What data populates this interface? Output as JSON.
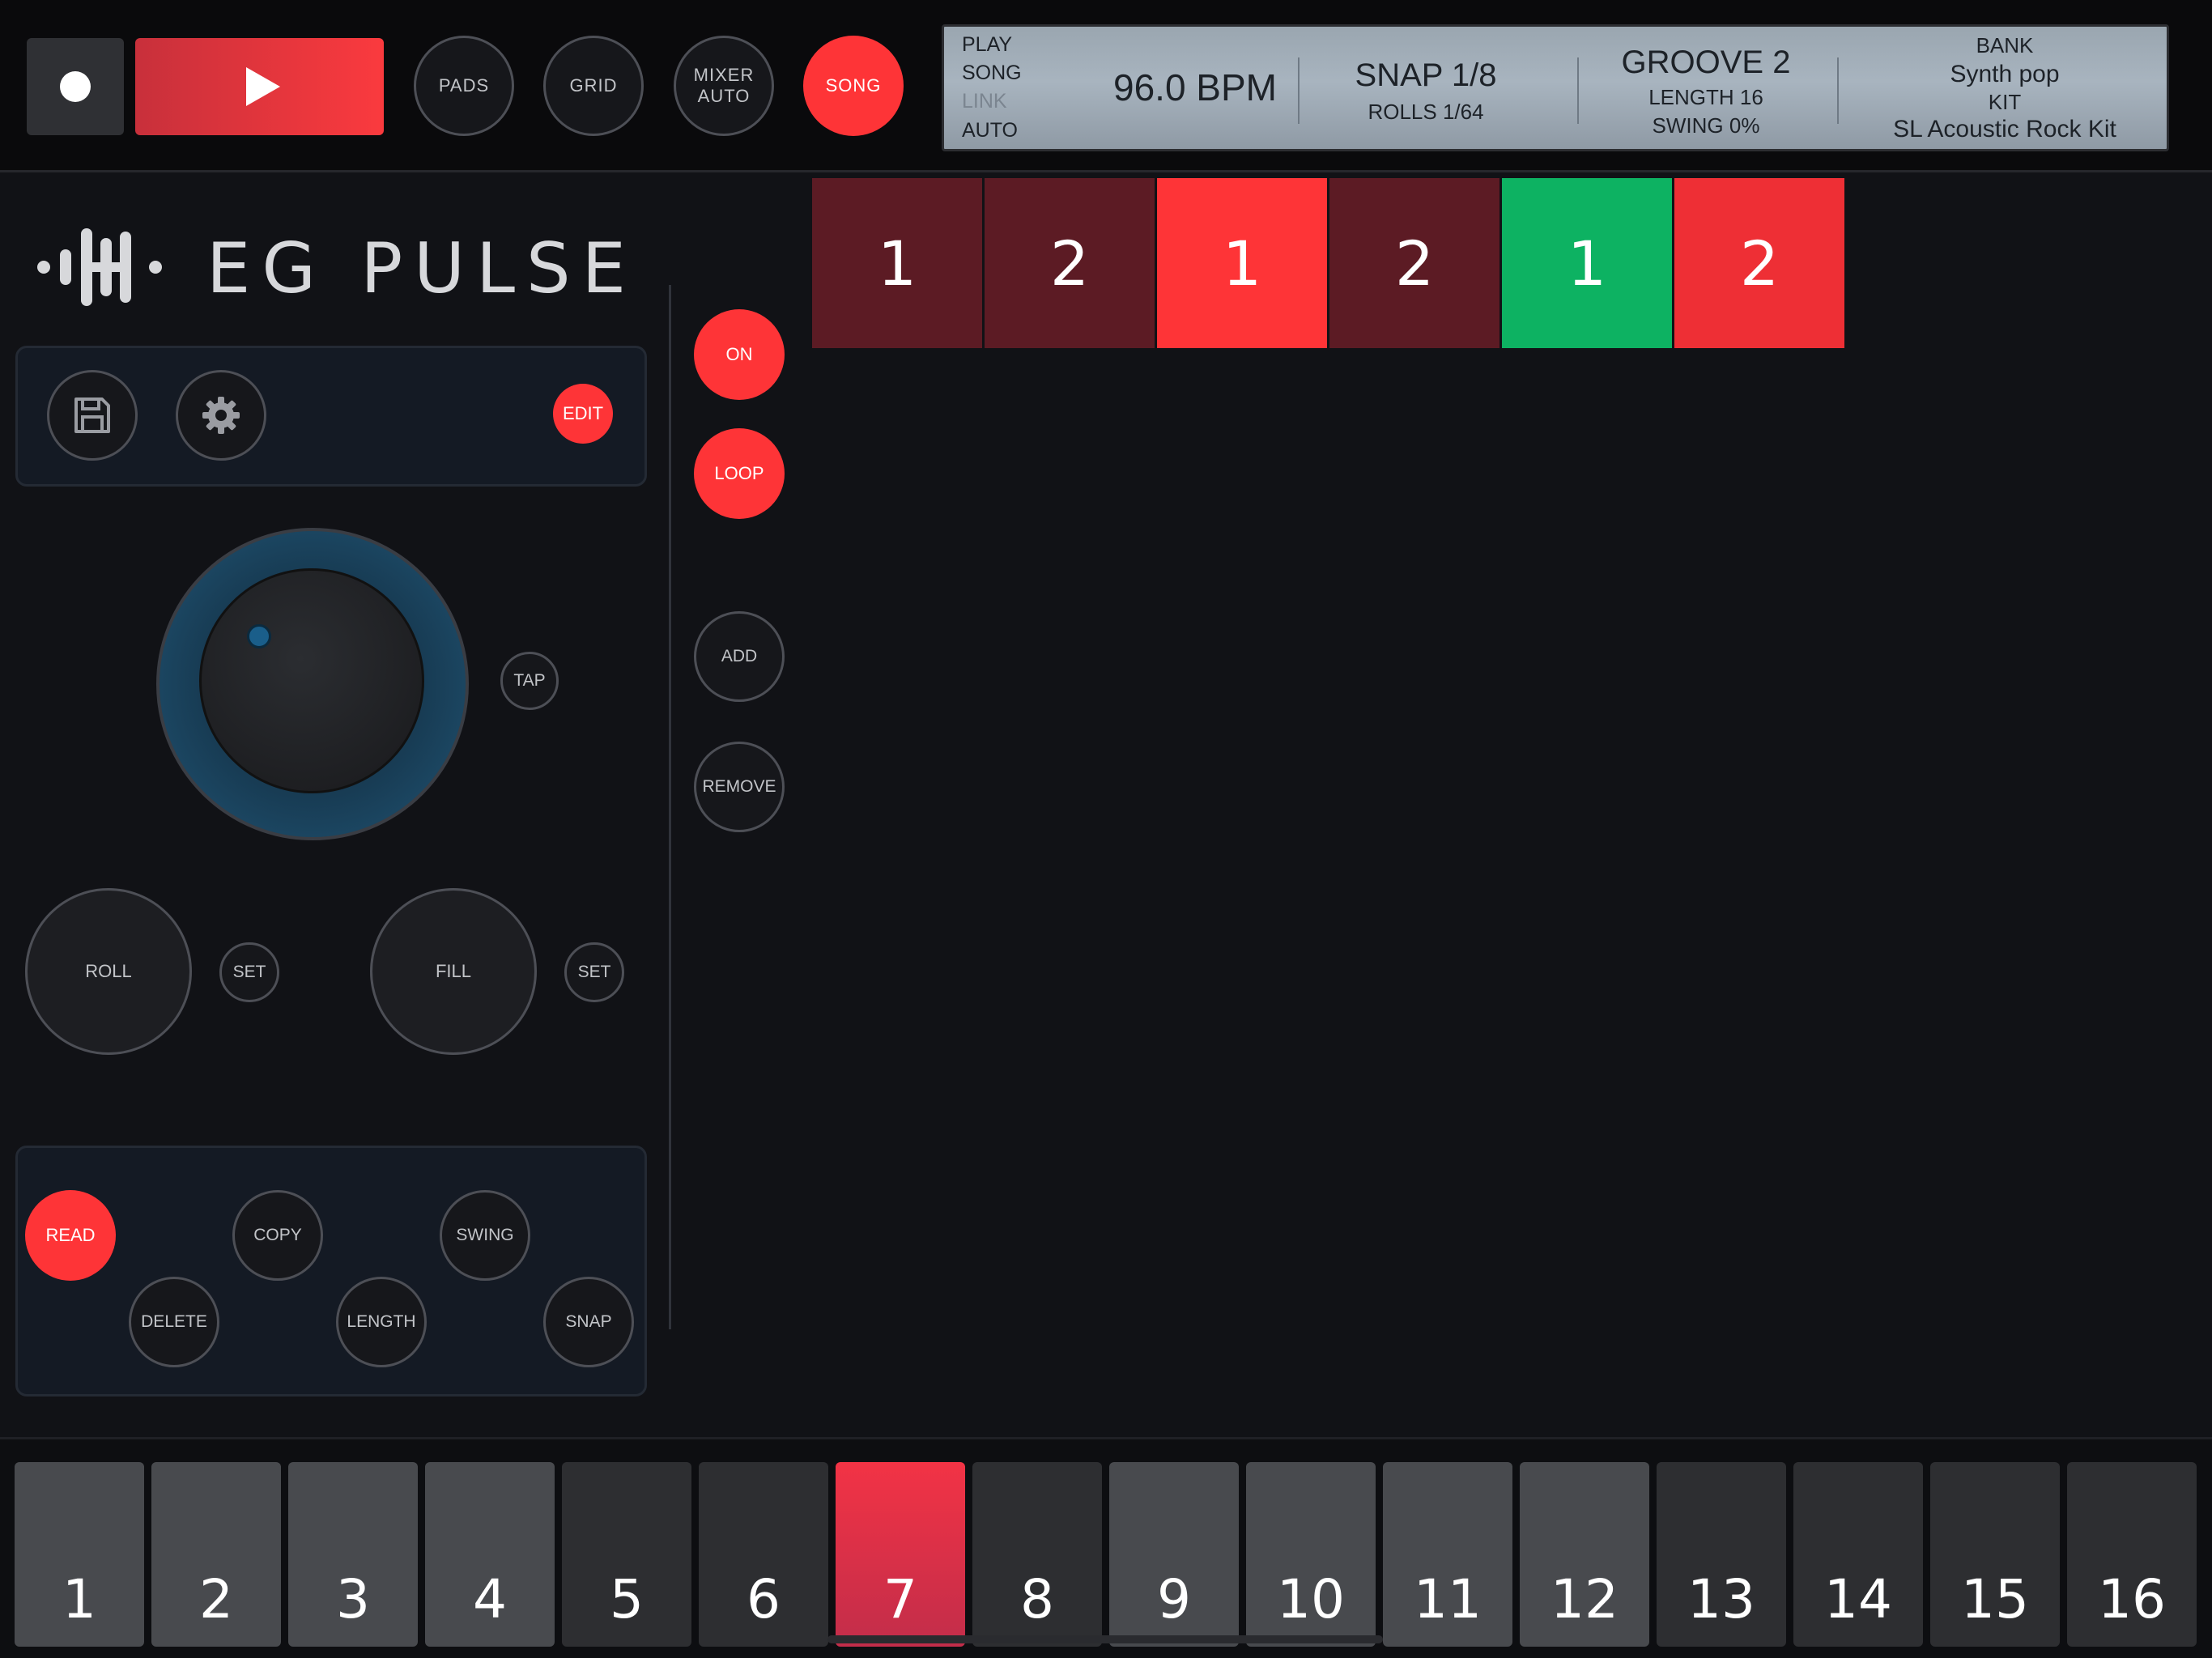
{
  "transport": {
    "record_icon": "record-icon",
    "play_icon": "play-icon"
  },
  "top_buttons": {
    "pads": "PADS",
    "grid": "GRID",
    "mixer_line1": "MIXER",
    "mixer_line2": "AUTO",
    "song": "SONG"
  },
  "lcd": {
    "modes": {
      "play": "PLAY",
      "song": "SONG",
      "link": "LINK",
      "auto": "AUTO"
    },
    "bpm": "96.0 BPM",
    "snap": "SNAP 1/8",
    "rolls": "ROLLS 1/64",
    "groove": "GROOVE 2",
    "length": "LENGTH 16",
    "swing": "SWING 0%",
    "bank_label": "BANK",
    "bank_value": "Synth pop",
    "kit_label": "KIT",
    "kit_value": "SL Acoustic Rock Kit"
  },
  "logo": {
    "text": "EG PULSE"
  },
  "toolbar": {
    "save_icon": "save-icon",
    "settings_icon": "gear-icon",
    "edit": "EDIT"
  },
  "tempo": {
    "tap": "TAP"
  },
  "perform": {
    "roll": "ROLL",
    "roll_set": "SET",
    "fill": "FILL",
    "fill_set": "SET"
  },
  "edit_panel": {
    "read": "READ",
    "copy": "COPY",
    "swing": "SWING",
    "delete": "DELETE",
    "length": "LENGTH",
    "snap": "SNAP"
  },
  "song_controls": {
    "on": "ON",
    "loop": "LOOP",
    "add": "ADD",
    "remove": "REMOVE"
  },
  "song_patterns": [
    {
      "label": "1",
      "color": "#5c1b24"
    },
    {
      "label": "2",
      "color": "#5c1b24"
    },
    {
      "label": "1",
      "color": "#fe3437"
    },
    {
      "label": "2",
      "color": "#5c1b24"
    },
    {
      "label": "1",
      "color": "#0db262"
    },
    {
      "label": "2",
      "color": "#ee2f35"
    }
  ],
  "pattern_pads": [
    {
      "label": "1"
    },
    {
      "label": "2"
    },
    {
      "label": "3"
    },
    {
      "label": "4"
    },
    {
      "label": "5"
    },
    {
      "label": "6"
    },
    {
      "label": "7"
    },
    {
      "label": "8"
    },
    {
      "label": "9"
    },
    {
      "label": "10"
    },
    {
      "label": "11"
    },
    {
      "label": "12"
    },
    {
      "label": "13"
    },
    {
      "label": "14"
    },
    {
      "label": "15"
    },
    {
      "label": "16"
    }
  ],
  "colors": {
    "accent": "#fe3437",
    "active_green": "#0db262",
    "knob_ring": "#1b4560"
  }
}
